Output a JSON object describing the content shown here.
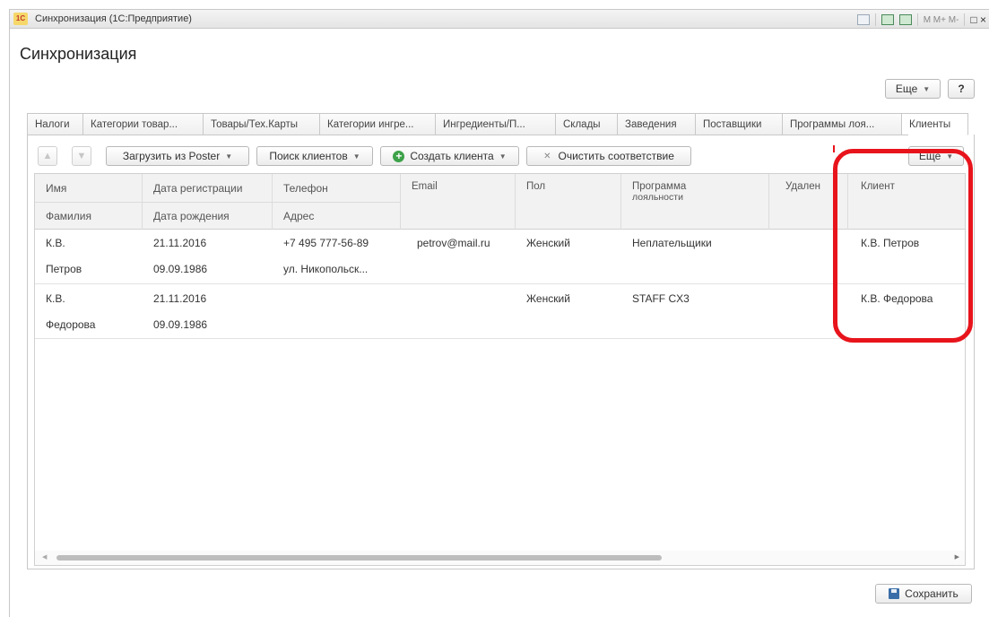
{
  "window": {
    "title": "Синхронизация  (1С:Предприятие)",
    "logo": "1С",
    "toolbar_icons": [
      "document-icon",
      "calendar-icon",
      "calendar-icon",
      "memory-icons",
      "window-icons"
    ],
    "mem_labels": "M  M+  M-",
    "win_labels": "□  ×"
  },
  "form": {
    "title": "Синхронизация",
    "more_label": "Еще",
    "help_label": "?"
  },
  "tabs": [
    {
      "label": "Налоги"
    },
    {
      "label": "Категории товар..."
    },
    {
      "label": "Товары/Тех.Карты"
    },
    {
      "label": "Категории ингре..."
    },
    {
      "label": "Ингредиенты/П..."
    },
    {
      "label": "Склады"
    },
    {
      "label": "Заведения"
    },
    {
      "label": "Поставщики"
    },
    {
      "label": "Программы лоя..."
    },
    {
      "label": "Клиенты",
      "active": true
    }
  ],
  "toolbar": {
    "up_icon": "arrow-up-icon",
    "down_icon": "arrow-down-icon",
    "load_label": "Загрузить из Poster",
    "search_label": "Поиск клиентов",
    "create_label": "Создать клиента",
    "clear_label": "Очистить соответствие",
    "more_label": "Еще"
  },
  "grid": {
    "headers": {
      "name": "Имя",
      "surname": "Фамилия",
      "reg_date": "Дата регистрации",
      "birth_date": "Дата рождения",
      "phone": "Телефон",
      "address": "Адрес",
      "email": "Email",
      "gender": "Пол",
      "loyalty_1": "Программа",
      "loyalty_2": "лояльности",
      "deleted": "Удален",
      "client": "Клиент"
    },
    "rows": [
      {
        "name": "К.В.",
        "surname": "Петров",
        "reg_date": "21.11.2016",
        "birth_date": "09.09.1986",
        "phone": "+7 495 777-56-89",
        "address": "ул. Никопольск...",
        "email": "petrov@mail.ru",
        "gender": "Женский",
        "loyalty": "Неплательщики",
        "deleted": "",
        "client": "К.В. Петров"
      },
      {
        "name": "К.В.",
        "surname": "Федорова",
        "reg_date": "21.11.2016",
        "birth_date": "09.09.1986",
        "phone": "",
        "address": "",
        "email": "",
        "gender": "Женский",
        "loyalty": "STAFF CX3",
        "deleted": "",
        "client": "К.В. Федорова"
      }
    ]
  },
  "footer": {
    "save_label": "Сохранить",
    "save_icon": "floppy-disk-icon"
  },
  "colors": {
    "highlight": "#e8141c",
    "accent_green": "#3da24a"
  }
}
